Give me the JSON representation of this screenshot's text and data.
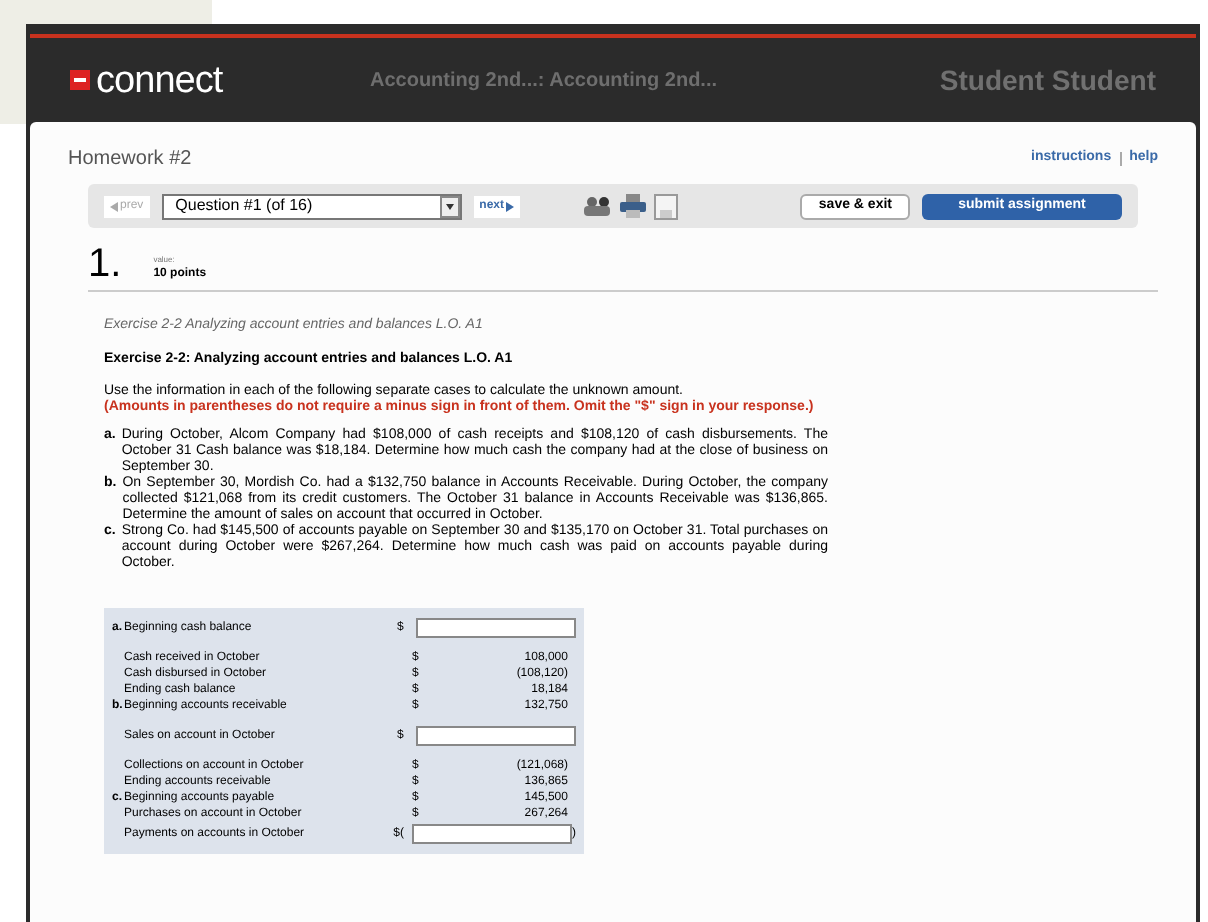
{
  "header": {
    "logo": "connect",
    "course": "Accounting 2nd...: Accounting 2nd...",
    "user": "Student Student"
  },
  "assignment": {
    "title": "Homework #2",
    "links": [
      "instructions",
      "help"
    ]
  },
  "toolbar": {
    "prev": {
      "label": "prev",
      "disabled": true
    },
    "question_select": "Question #1 (of 16)",
    "next": {
      "label": "next",
      "disabled": false
    },
    "save_exit": "save & exit",
    "submit": "submit assignment"
  },
  "question": {
    "number": "1.",
    "value_label": "value:",
    "points": "10 points",
    "exercise_link": "Exercise 2-2 Analyzing account entries and balances L.O. A1",
    "exercise_title": "Exercise 2-2: Analyzing account entries and balances L.O. A1",
    "instructions": "Use the information in each of the following separate cases to calculate the unknown amount.",
    "warning": "(Amounts in parentheses do not require a minus sign in front of them. Omit the \"$\" sign in your response.)",
    "cases": [
      {
        "marker": "a.",
        "text": "During October, Alcom Company had $108,000 of cash receipts and $108,120 of cash disbursements. The October 31 Cash balance was $18,184. Determine how much cash the company had at the close of business on September 30."
      },
      {
        "marker": "b.",
        "text": "On September 30, Mordish Co. had a $132,750 balance in Accounts Receivable. During October, the company collected $121,068 from its credit customers. The October 31 balance in Accounts Receivable was $136,865. Determine the amount of sales on account that occurred in October."
      },
      {
        "marker": "c.",
        "text": "Strong Co. had $145,500 of accounts payable on September 30 and $135,170 on October 31. Total purchases on account during October were $267,264. Determine how much cash was paid on accounts payable during October."
      }
    ],
    "table": [
      [
        {
          "marker": "a.",
          "label": "Beginning cash balance",
          "currency": "$",
          "kind": "input"
        }
      ],
      [
        {
          "label": "Cash received in October",
          "currency": "$",
          "kind": "value",
          "value": "108,000"
        },
        {
          "label": "Cash disbursed in October",
          "currency": "$",
          "kind": "value",
          "value": "(108,120)"
        },
        {
          "label": "Ending cash balance",
          "currency": "$",
          "kind": "value",
          "value": "18,184"
        },
        {
          "marker": "b.",
          "label": "Beginning accounts receivable",
          "currency": "$",
          "kind": "value",
          "value": "132,750"
        }
      ],
      [
        {
          "label": "Sales on account in October",
          "currency": "$",
          "kind": "input"
        }
      ],
      [
        {
          "label": "Collections on account in October",
          "currency": "$",
          "kind": "value",
          "value": "(121,068)"
        },
        {
          "label": "Ending accounts receivable",
          "currency": "$",
          "kind": "value",
          "value": "136,865"
        },
        {
          "marker": "c.",
          "label": "Beginning accounts payable",
          "currency": "$",
          "kind": "value",
          "value": "145,500"
        },
        {
          "label": "Purchases on account in October",
          "currency": "$",
          "kind": "value",
          "value": "267,264"
        },
        {
          "label": "Payments on accounts in October",
          "currency": "$(",
          "kind": "input",
          "suffix": ")"
        }
      ]
    ]
  }
}
